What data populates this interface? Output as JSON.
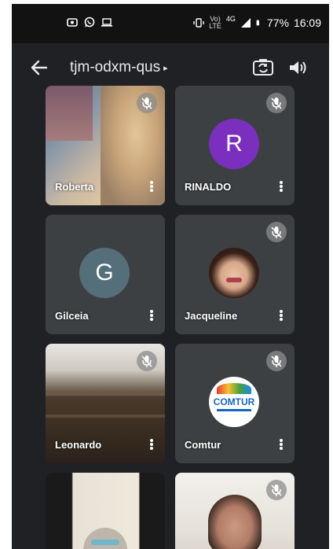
{
  "status_bar": {
    "network": "4G",
    "volte_top": "Vo)",
    "volte_bottom": "LTE",
    "battery": "77%",
    "time": "16:09"
  },
  "meeting": {
    "code": "tjm-odxm-qus",
    "caret": "▸"
  },
  "participants": [
    {
      "name": "Roberta",
      "avatar_type": "video",
      "muted": true
    },
    {
      "name": "RINALDO",
      "avatar_type": "letter",
      "letter": "R",
      "avatar_color": "#7B2FBE",
      "muted": true
    },
    {
      "name": "Gilceia",
      "avatar_type": "letter",
      "letter": "G",
      "avatar_color": "#546E7A",
      "muted": false
    },
    {
      "name": "Jacqueline",
      "avatar_type": "photo",
      "muted": true
    },
    {
      "name": "Leonardo",
      "avatar_type": "video",
      "muted": true
    },
    {
      "name": "Comtur",
      "avatar_type": "logo",
      "logo_text": "COMTUR",
      "muted": true
    },
    {
      "name": "",
      "avatar_type": "video",
      "muted": false
    },
    {
      "name": "",
      "avatar_type": "video",
      "muted": true
    }
  ],
  "colors": {
    "background": "#202124",
    "tile": "#3c4043",
    "status_bar": "#121212"
  }
}
